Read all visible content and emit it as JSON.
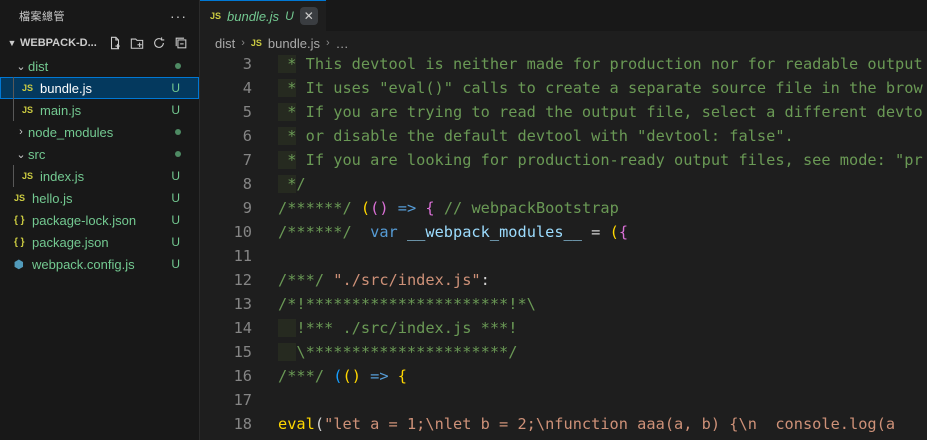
{
  "sidebar": {
    "title": "檔案總管",
    "more": "···",
    "project": "WEBPACK-D...",
    "tree": [
      {
        "label": "dist",
        "type": "folder",
        "open": true,
        "status": "dot"
      },
      {
        "label": "bundle.js",
        "type": "js",
        "status": "U",
        "selected": true
      },
      {
        "label": "main.js",
        "type": "js",
        "status": "U"
      },
      {
        "label": "node_modules",
        "type": "folder",
        "open": false,
        "status": "dot"
      },
      {
        "label": "src",
        "type": "folder",
        "open": true,
        "status": "dot"
      },
      {
        "label": "index.js",
        "type": "js",
        "status": "U"
      },
      {
        "label": "hello.js",
        "type": "js",
        "status": "U"
      },
      {
        "label": "package-lock.json",
        "type": "json",
        "status": "U"
      },
      {
        "label": "package.json",
        "type": "json",
        "status": "U"
      },
      {
        "label": "webpack.config.js",
        "type": "webpack",
        "status": "U"
      }
    ]
  },
  "icons": {
    "js": "JS",
    "json": "{ }",
    "webpack": "⬢",
    "folder_open": "⌄",
    "folder_closed": "›"
  },
  "tab": {
    "name": "bundle.js",
    "status": "U",
    "close": "✕"
  },
  "breadcrumb": {
    "dir": "dist",
    "file": "bundle.js",
    "sep": "›",
    "more": "…"
  },
  "colors": {
    "accent": "#0078d4",
    "untracked": "#73c991",
    "comment": "#6a9955",
    "string": "#ce9178",
    "keyword": "#569cd6"
  },
  "code": [
    {
      "n": "3",
      "t": " * This devtool is neither made for production nor for readable output"
    },
    {
      "n": "4",
      "t": " * It uses \"eval()\" calls to create a separate source file in the brow"
    },
    {
      "n": "5",
      "t": " * If you are trying to read the output file, select a different devto"
    },
    {
      "n": "6",
      "t": " * or disable the default devtool with \"devtool: false\"."
    },
    {
      "n": "7",
      "t": " * If you are looking for production-ready output files, see mode: \"pr"
    },
    {
      "n": "8",
      "t": " */"
    },
    {
      "n": "9",
      "t": "/******/ (() => { // webpackBootstrap"
    },
    {
      "n": "10",
      "t": "/******/  var __webpack_modules__ = ({"
    },
    {
      "n": "11",
      "t": ""
    },
    {
      "n": "12",
      "t": "/***/ \"./src/index.js\":"
    },
    {
      "n": "13",
      "t": "/*!**********************!*\\"
    },
    {
      "n": "14",
      "t": "  !*** ./src/index.js ***!"
    },
    {
      "n": "15",
      "t": "  \\**********************/"
    },
    {
      "n": "16",
      "t": "/***/ (() => {"
    },
    {
      "n": "17",
      "t": ""
    },
    {
      "n": "18",
      "t": "eval(\"let a = 1;\\nlet b = 2;\\nfunction aaa(a, b) {\\n  console.log(a"
    }
  ]
}
